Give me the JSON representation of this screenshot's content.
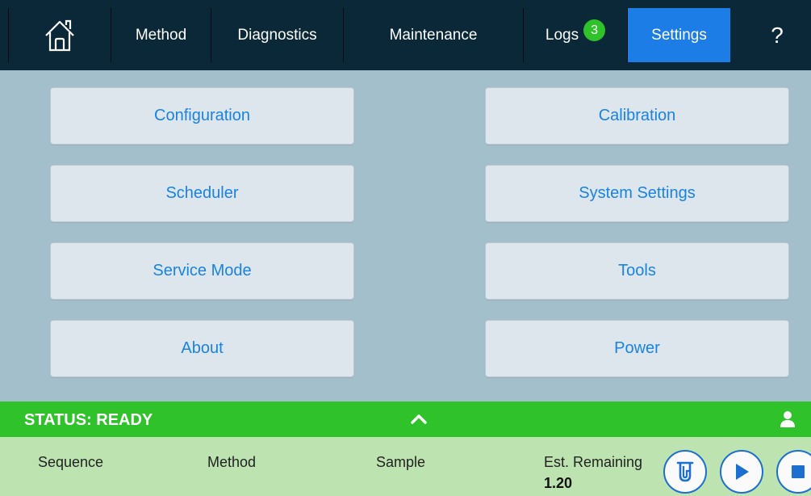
{
  "nav": {
    "home_icon": "home-icon",
    "items": [
      {
        "label": "Method"
      },
      {
        "label": "Diagnostics"
      },
      {
        "label": "Maintenance"
      },
      {
        "label": "Logs"
      },
      {
        "label": "Settings"
      }
    ],
    "logs_badge": "3",
    "help_label": "?",
    "active_tab": "Settings",
    "active_color": "#1c7de6",
    "badge_color": "#2fc22a"
  },
  "settings_menu": {
    "left": [
      {
        "label": "Configuration"
      },
      {
        "label": "Scheduler"
      },
      {
        "label": "Service Mode"
      },
      {
        "label": "About"
      }
    ],
    "right": [
      {
        "label": "Calibration"
      },
      {
        "label": "System Settings"
      },
      {
        "label": "Tools"
      },
      {
        "label": "Power"
      }
    ]
  },
  "status": {
    "text": "STATUS: READY",
    "color": "#2fc22a",
    "expand_icon": "chevron-up-icon",
    "user_icon": "user-icon"
  },
  "info": {
    "sequence_label": "Sequence",
    "method_label": "Method",
    "sample_label": "Sample",
    "est_remaining_label": "Est. Remaining",
    "est_remaining_value": "1.20"
  },
  "controls": {
    "probe_icon": "probe-icon",
    "play_icon": "play-icon",
    "stop_icon": "stop-icon"
  }
}
